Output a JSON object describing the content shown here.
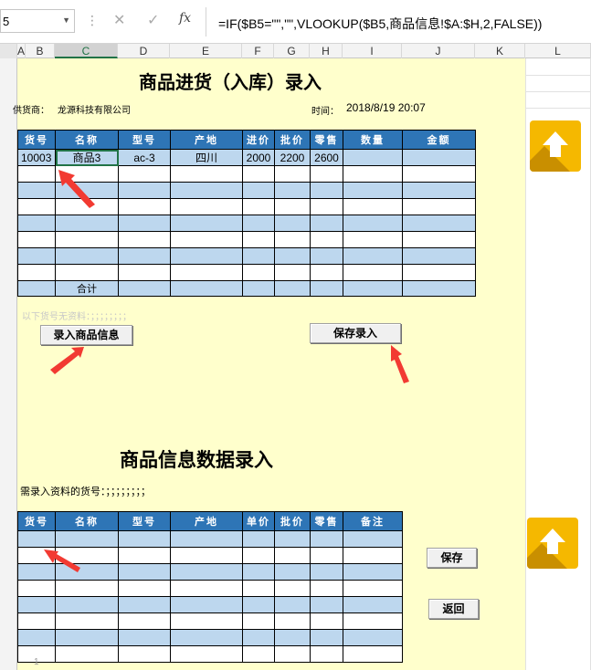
{
  "formula_bar": {
    "name_box": "5",
    "formula": "=IF($B5=\"\",\"\",VLOOKUP($B5,商品信息!$A:$H,2,FALSE))",
    "cancel_icon": "✕",
    "enter_icon": "✓",
    "fx_icon": "fx"
  },
  "columns": [
    "A",
    "B",
    "C",
    "D",
    "E",
    "F",
    "G",
    "H",
    "I",
    "J",
    "K",
    "L"
  ],
  "stock_in": {
    "title": "商品进货（入库）录入",
    "supplier_label": "供货商：",
    "supplier_value": "龙源科技有限公司",
    "time_label": "时间：",
    "time_value": "2018/8/19 20:07",
    "headers": [
      "货号",
      "名称",
      "型号",
      "产地",
      "进价",
      "批价",
      "零售",
      "数量",
      "金额"
    ],
    "row1": [
      "10003",
      "商品3",
      "ac-3",
      "四川",
      "2000",
      "2200",
      "2600",
      "",
      ""
    ],
    "total_label": "合计",
    "note": "以下货号无资料：；；；；；；；；",
    "btn_enter_product": "录入商品信息",
    "btn_save_entry": "保存录入"
  },
  "product_info": {
    "title": "商品信息数据录入",
    "need_label": "需录入资料的货号：；；；；；；；；",
    "headers": [
      "货号",
      "名称",
      "型号",
      "产地",
      "单价",
      "批价",
      "零售",
      "备注"
    ],
    "btn_save": "保存",
    "btn_back": "返回",
    "row_number": "1"
  },
  "colors": {
    "header_blue": "#2e75b6",
    "band_blue": "#bdd7ee",
    "sheet_yellow": "#ffffcc",
    "icon_orange": "#f5b800",
    "arrow_red": "#f23a32"
  }
}
